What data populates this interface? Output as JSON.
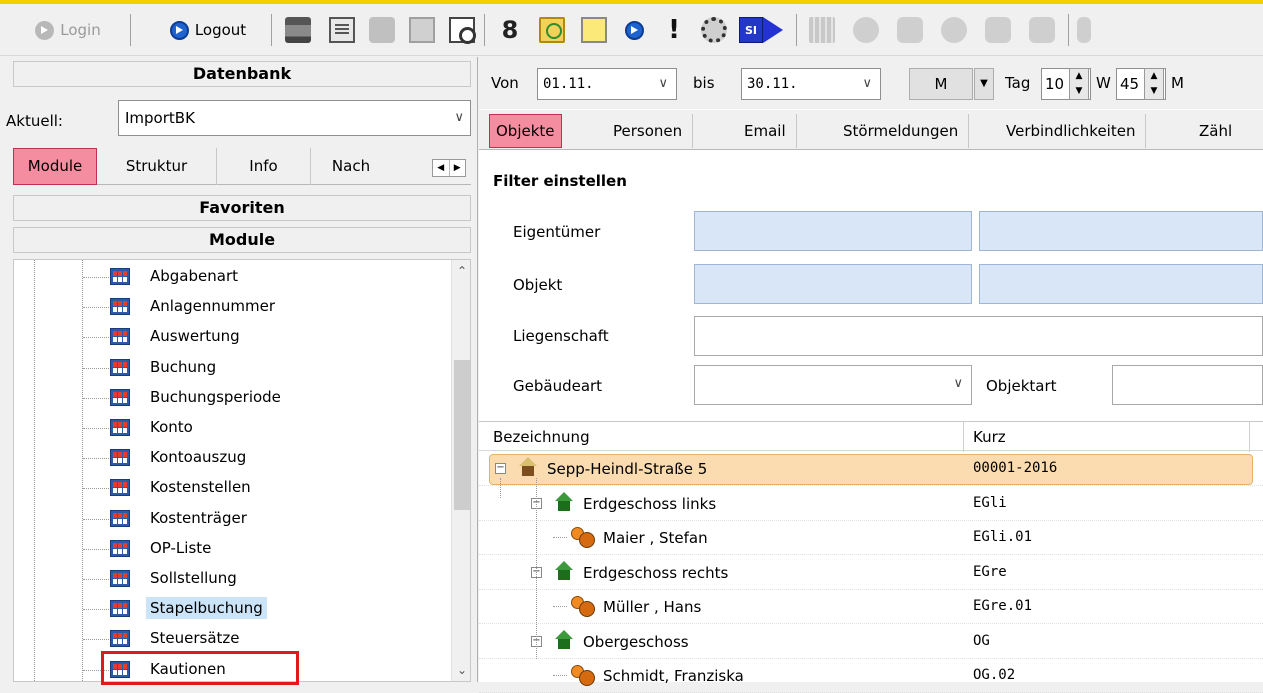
{
  "toolbar": {
    "login_label": "Login",
    "logout_label": "Logout"
  },
  "leftpanel": {
    "datenbank_title": "Datenbank",
    "aktuell_label": "Aktuell:",
    "aktuell_value": "ImportBK",
    "tabs": [
      "Module",
      "Struktur",
      "Info",
      "Nach"
    ],
    "favoriten_title": "Favoriten",
    "module_title": "Module",
    "tree_items": [
      "Abgabenart",
      "Anlagennummer",
      "Auswertung",
      "Buchung",
      "Buchungsperiode",
      "Konto",
      "Kontoauszug",
      "Kostenstellen",
      "Kostenträger",
      "OP-Liste",
      "Sollstellung",
      "Stapelbuchung",
      "Steuersätze",
      "Kautionen"
    ],
    "selected_item": "Stapelbuchung"
  },
  "rightpanel": {
    "von_label": "Von",
    "von_value": "01.11.",
    "bis_label": "bis",
    "bis_value": "30.11.",
    "mode_button": "M",
    "tag_label": "Tag",
    "tag_value": "10",
    "w_label": "W",
    "w_value": "45",
    "m_label": "M",
    "tabs": [
      "Objekte",
      "Personen",
      "Email",
      "Störmeldungen",
      "Verbindlichkeiten",
      "Zähl"
    ],
    "filter_title": "Filter einstellen",
    "filter": {
      "eigentuemer_label": "Eigentümer",
      "objekt_label": "Objekt",
      "liegenschaft_label": "Liegenschaft",
      "gebaeudeart_label": "Gebäudeart",
      "objektart_label": "Objektart"
    },
    "grid": {
      "col_bezeichnung": "Bezeichnung",
      "col_kurz": "Kurz",
      "rows": [
        {
          "name": "Sepp-Heindl-Straße 5",
          "kurz": "00001-2016"
        },
        {
          "name": "Erdgeschoss links",
          "kurz": "EGli"
        },
        {
          "name": "Maier , Stefan",
          "kurz": "EGli.01"
        },
        {
          "name": "Erdgeschoss rechts",
          "kurz": "EGre"
        },
        {
          "name": "Müller , Hans",
          "kurz": "EGre.01"
        },
        {
          "name": "Obergeschoss",
          "kurz": "OG"
        },
        {
          "name": "Schmidt, Franziska",
          "kurz": "OG.02"
        }
      ]
    }
  },
  "colors": {
    "active_tab": "#f58da0",
    "filter_input": "#d8e6f8",
    "selected_row": "#fbdcb0",
    "highlight_border": "#e01a1a",
    "top_strip": "#f5d000"
  }
}
